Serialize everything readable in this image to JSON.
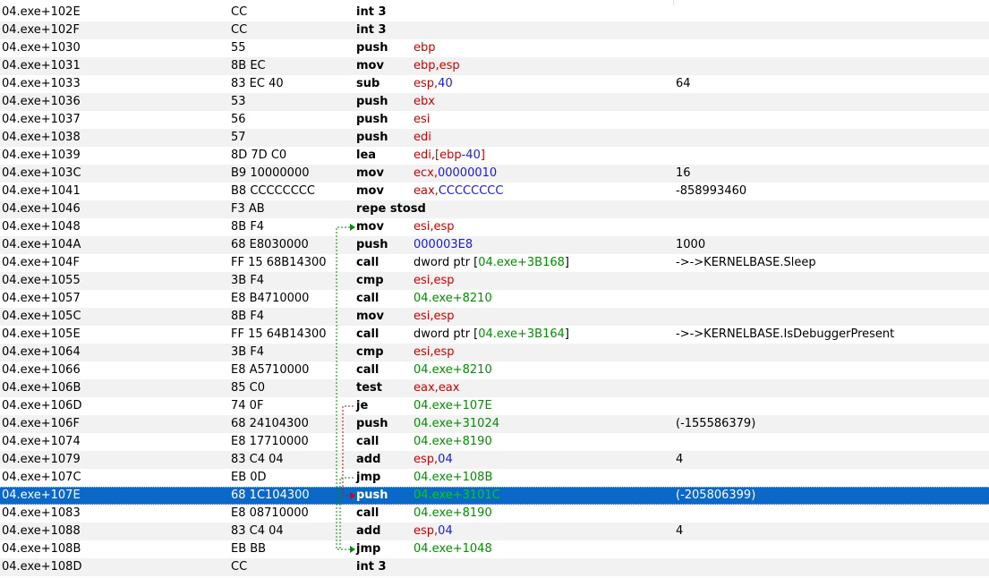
{
  "rows": [
    {
      "addr": "04.exe+102E",
      "bytes": "CC",
      "mnemonic": "int 3",
      "operands": [],
      "comment": ""
    },
    {
      "addr": "04.exe+102F",
      "bytes": "CC",
      "mnemonic": "int 3",
      "operands": [],
      "comment": ""
    },
    {
      "addr": "04.exe+1030",
      "bytes": "55",
      "mnemonic": "push",
      "operands": [
        {
          "t": "ebp",
          "c": "reg"
        }
      ],
      "comment": ""
    },
    {
      "addr": "04.exe+1031",
      "bytes": "8B EC",
      "mnemonic": "mov",
      "operands": [
        {
          "t": "ebp",
          "c": "reg"
        },
        {
          "t": ",",
          "c": "reg"
        },
        {
          "t": "esp",
          "c": "reg"
        }
      ],
      "comment": ""
    },
    {
      "addr": "04.exe+1033",
      "bytes": "83 EC 40",
      "mnemonic": "sub",
      "operands": [
        {
          "t": "esp",
          "c": "reg"
        },
        {
          "t": ",",
          "c": "reg"
        },
        {
          "t": "40",
          "c": "imm"
        }
      ],
      "comment": "64"
    },
    {
      "addr": "04.exe+1036",
      "bytes": "53",
      "mnemonic": "push",
      "operands": [
        {
          "t": "ebx",
          "c": "reg"
        }
      ],
      "comment": ""
    },
    {
      "addr": "04.exe+1037",
      "bytes": "56",
      "mnemonic": "push",
      "operands": [
        {
          "t": "esi",
          "c": "reg"
        }
      ],
      "comment": ""
    },
    {
      "addr": "04.exe+1038",
      "bytes": "57",
      "mnemonic": "push",
      "operands": [
        {
          "t": "edi",
          "c": "reg"
        }
      ],
      "comment": ""
    },
    {
      "addr": "04.exe+1039",
      "bytes": "8D 7D C0",
      "mnemonic": "lea",
      "operands": [
        {
          "t": "edi",
          "c": "reg"
        },
        {
          "t": ",[",
          "c": "reg"
        },
        {
          "t": "ebp",
          "c": "reg"
        },
        {
          "t": "-40",
          "c": "imm"
        },
        {
          "t": "]",
          "c": "reg"
        }
      ],
      "comment": ""
    },
    {
      "addr": "04.exe+103C",
      "bytes": "B9 10000000",
      "mnemonic": "mov",
      "operands": [
        {
          "t": "ecx",
          "c": "reg"
        },
        {
          "t": ",",
          "c": "reg"
        },
        {
          "t": "00000010",
          "c": "imm"
        }
      ],
      "comment": "16"
    },
    {
      "addr": "04.exe+1041",
      "bytes": "B8 CCCCCCCC",
      "mnemonic": "mov",
      "operands": [
        {
          "t": "eax",
          "c": "reg"
        },
        {
          "t": ",",
          "c": "reg"
        },
        {
          "t": "CCCCCCCC",
          "c": "imm"
        }
      ],
      "comment": "-858993460"
    },
    {
      "addr": "04.exe+1046",
      "bytes": "F3 AB",
      "mnemonic": "repe stosd",
      "operands": [],
      "comment": ""
    },
    {
      "addr": "04.exe+1048",
      "bytes": "8B F4",
      "mnemonic": "mov",
      "operands": [
        {
          "t": "esi",
          "c": "reg"
        },
        {
          "t": ",",
          "c": "reg"
        },
        {
          "t": "esp",
          "c": "reg"
        }
      ],
      "comment": ""
    },
    {
      "addr": "04.exe+104A",
      "bytes": "68 E8030000",
      "mnemonic": "push",
      "operands": [
        {
          "t": "000003E8",
          "c": "imm"
        }
      ],
      "comment": "1000"
    },
    {
      "addr": "04.exe+104F",
      "bytes": "FF 15 68B14300",
      "mnemonic": "call",
      "operands": [
        {
          "t": "dword ptr [",
          "c": "mem"
        },
        {
          "t": "04.exe+3B168",
          "c": "addr"
        },
        {
          "t": "]",
          "c": "mem"
        }
      ],
      "comment": "->->KERNELBASE.Sleep"
    },
    {
      "addr": "04.exe+1055",
      "bytes": "3B F4",
      "mnemonic": "cmp",
      "operands": [
        {
          "t": "esi",
          "c": "reg"
        },
        {
          "t": ",",
          "c": "reg"
        },
        {
          "t": "esp",
          "c": "reg"
        }
      ],
      "comment": ""
    },
    {
      "addr": "04.exe+1057",
      "bytes": "E8 B4710000",
      "mnemonic": "call",
      "operands": [
        {
          "t": "04.exe+8210",
          "c": "addr"
        }
      ],
      "comment": ""
    },
    {
      "addr": "04.exe+105C",
      "bytes": "8B F4",
      "mnemonic": "mov",
      "operands": [
        {
          "t": "esi",
          "c": "reg"
        },
        {
          "t": ",",
          "c": "reg"
        },
        {
          "t": "esp",
          "c": "reg"
        }
      ],
      "comment": ""
    },
    {
      "addr": "04.exe+105E",
      "bytes": "FF 15 64B14300",
      "mnemonic": "call",
      "operands": [
        {
          "t": "dword ptr [",
          "c": "mem"
        },
        {
          "t": "04.exe+3B164",
          "c": "addr"
        },
        {
          "t": "]",
          "c": "mem"
        }
      ],
      "comment": "->->KERNELBASE.IsDebuggerPresent"
    },
    {
      "addr": "04.exe+1064",
      "bytes": "3B F4",
      "mnemonic": "cmp",
      "operands": [
        {
          "t": "esi",
          "c": "reg"
        },
        {
          "t": ",",
          "c": "reg"
        },
        {
          "t": "esp",
          "c": "reg"
        }
      ],
      "comment": ""
    },
    {
      "addr": "04.exe+1066",
      "bytes": "E8 A5710000",
      "mnemonic": "call",
      "operands": [
        {
          "t": "04.exe+8210",
          "c": "addr"
        }
      ],
      "comment": ""
    },
    {
      "addr": "04.exe+106B",
      "bytes": "85 C0",
      "mnemonic": "test",
      "operands": [
        {
          "t": "eax",
          "c": "reg"
        },
        {
          "t": ",",
          "c": "reg"
        },
        {
          "t": "eax",
          "c": "reg"
        }
      ],
      "comment": ""
    },
    {
      "addr": "04.exe+106D",
      "bytes": "74 0F",
      "mnemonic": "je",
      "operands": [
        {
          "t": "04.exe+107E",
          "c": "addr"
        }
      ],
      "comment": ""
    },
    {
      "addr": "04.exe+106F",
      "bytes": "68 24104300",
      "mnemonic": "push",
      "operands": [
        {
          "t": "04.exe+31024",
          "c": "addr"
        }
      ],
      "comment": "(-155586379)"
    },
    {
      "addr": "04.exe+1074",
      "bytes": "E8 17710000",
      "mnemonic": "call",
      "operands": [
        {
          "t": "04.exe+8190",
          "c": "addr"
        }
      ],
      "comment": ""
    },
    {
      "addr": "04.exe+1079",
      "bytes": "83 C4 04",
      "mnemonic": "add",
      "operands": [
        {
          "t": "esp",
          "c": "reg"
        },
        {
          "t": ",",
          "c": "reg"
        },
        {
          "t": "04",
          "c": "imm"
        }
      ],
      "comment": "4"
    },
    {
      "addr": "04.exe+107C",
      "bytes": "EB 0D",
      "mnemonic": "jmp",
      "operands": [
        {
          "t": "04.exe+108B",
          "c": "addr"
        }
      ],
      "comment": ""
    },
    {
      "addr": "04.exe+107E",
      "bytes": "68 1C104300",
      "mnemonic": "push",
      "operands": [
        {
          "t": "04.exe+3101C",
          "c": "addr"
        }
      ],
      "comment": "(-205806399)",
      "selected": true
    },
    {
      "addr": "04.exe+1083",
      "bytes": "E8 08710000",
      "mnemonic": "call",
      "operands": [
        {
          "t": "04.exe+8190",
          "c": "addr"
        }
      ],
      "comment": ""
    },
    {
      "addr": "04.exe+1088",
      "bytes": "83 C4 04",
      "mnemonic": "add",
      "operands": [
        {
          "t": "esp",
          "c": "reg"
        },
        {
          "t": ",",
          "c": "reg"
        },
        {
          "t": "04",
          "c": "imm"
        }
      ],
      "comment": "4"
    },
    {
      "addr": "04.exe+108B",
      "bytes": "EB BB",
      "mnemonic": "jmp",
      "operands": [
        {
          "t": "04.exe+1048",
          "c": "addr"
        }
      ],
      "comment": ""
    },
    {
      "addr": "04.exe+108D",
      "bytes": "CC",
      "mnemonic": "int 3",
      "operands": [],
      "comment": ""
    }
  ],
  "colors": {
    "register": "#d00000",
    "immediate": "#1a1ae0",
    "address": "#009000",
    "selection": "#0a68c8",
    "jump_taken": "#e00000",
    "jump_untaken": "#009000"
  },
  "jumps": [
    {
      "from": 22,
      "to": 27,
      "color": "jump_taken"
    },
    {
      "from": 26,
      "to": 30,
      "color": "jump_untaken"
    },
    {
      "from": 30,
      "to": 12,
      "color": "jump_untaken"
    }
  ]
}
